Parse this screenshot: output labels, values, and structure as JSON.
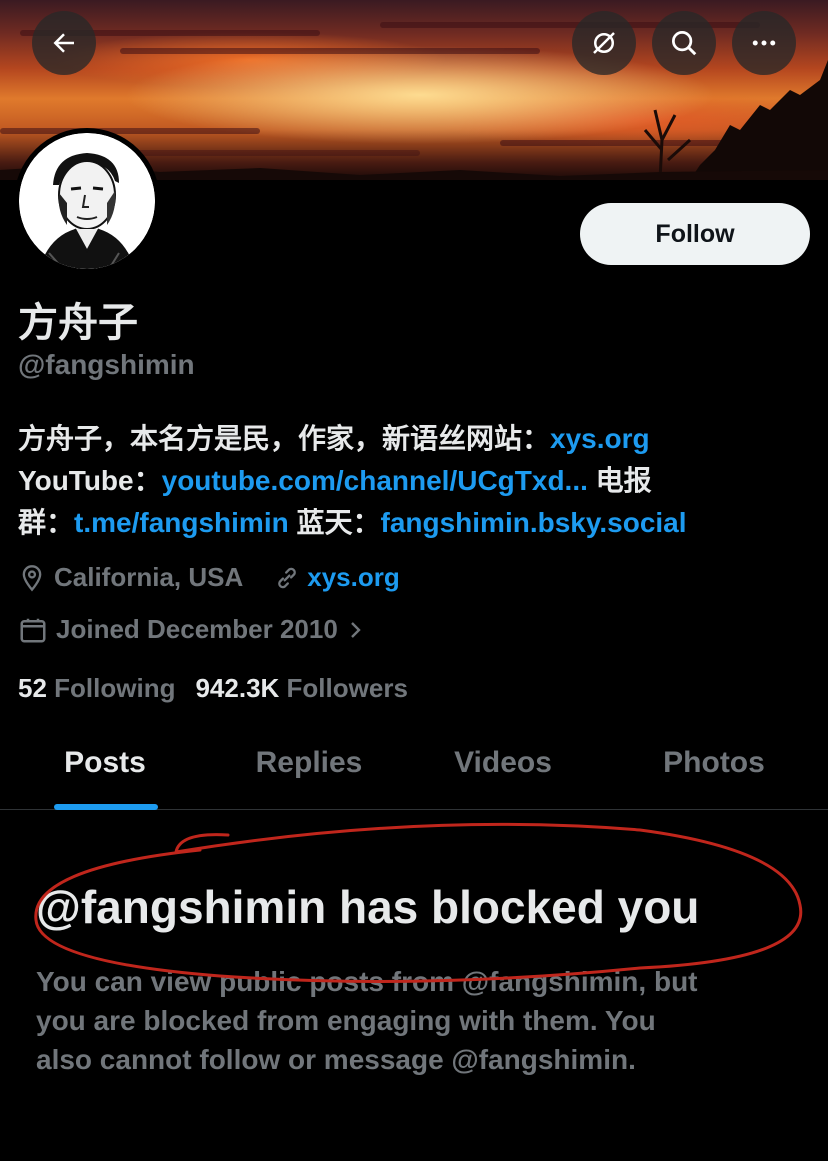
{
  "header": {
    "back_icon": "arrow-left-icon",
    "cross_icon": "circle-slash-icon",
    "search_icon": "search-icon",
    "more_icon": "more-horizontal-icon"
  },
  "profile": {
    "display_name": "方舟子",
    "handle": "@fangshimin",
    "follow_label": "Follow",
    "bio": {
      "line1_text": "方舟子，本名方是民，作家，新语丝网站：",
      "line1_link": "xys.org",
      "line2_text": "YouTube：",
      "line2_link": "youtube.com/channel/UCgTxd...",
      "line2_suffix": " 电报",
      "line3_text": "群：",
      "line3_link": "t.me/fangshimin",
      "line3_mid": " 蓝天：",
      "line3_link2": "fangshimin.bsky.social"
    },
    "location": "California, USA",
    "website": "xys.org",
    "joined": "Joined December 2010",
    "following_count": "52",
    "following_label": "Following",
    "followers_count": "942.3K",
    "followers_label": "Followers"
  },
  "tabs": [
    {
      "label": "Posts",
      "active": true
    },
    {
      "label": "Replies",
      "active": false
    },
    {
      "label": "Videos",
      "active": false
    },
    {
      "label": "Photos",
      "active": false
    }
  ],
  "blocked": {
    "title": "@fangshimin has blocked you",
    "body_line1": "You can view public posts from @fangshimin, but",
    "body_line2": "you are blocked from engaging with them. You",
    "body_line3": "also cannot follow or message @fangshimin."
  },
  "colors": {
    "accent": "#1d9bf0",
    "muted": "#71767b",
    "text": "#e7e9ea",
    "annotation": "#c0261c"
  }
}
